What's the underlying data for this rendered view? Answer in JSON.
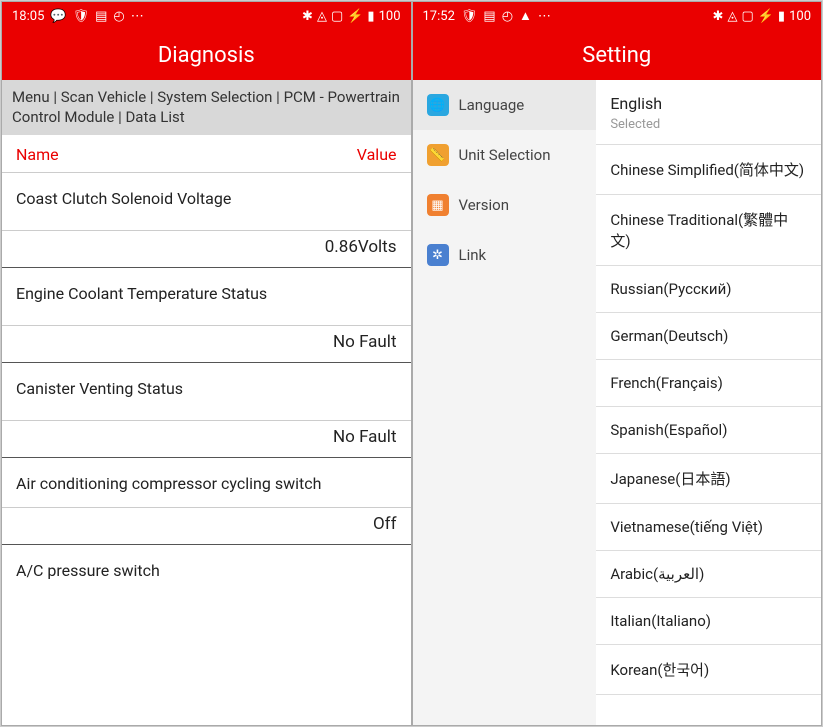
{
  "left": {
    "status": {
      "time": "18:05",
      "battery": "100"
    },
    "title": "Diagnosis",
    "breadcrumb": "Menu | Scan Vehicle | System Selection | PCM - Powertrain Control Module | Data List",
    "col_name": "Name",
    "col_value": "Value",
    "rows": [
      {
        "name": "Coast Clutch Solenoid Voltage",
        "value": "0.86Volts"
      },
      {
        "name": "Engine Coolant Temperature Status",
        "value": "No Fault"
      },
      {
        "name": "Canister Venting Status",
        "value": "No Fault"
      },
      {
        "name": "Air conditioning compressor cycling switch",
        "value": "Off"
      },
      {
        "name": "A/C pressure switch",
        "value": ""
      }
    ]
  },
  "right": {
    "status": {
      "time": "17:52",
      "battery": "100"
    },
    "title": "Setting",
    "menu": [
      {
        "label": "Language"
      },
      {
        "label": "Unit Selection"
      },
      {
        "label": "Version"
      },
      {
        "label": "Link"
      }
    ],
    "selected_lang": "English",
    "selected_sub": "Selected",
    "languages": [
      "Chinese Simplified(简体中文)",
      "Chinese Traditional(繁體中文)",
      "Russian(Русский)",
      "German(Deutsch)",
      "French(Français)",
      "Spanish(Español)",
      "Japanese(日本語)",
      "Vietnamese(tiếng Việt)",
      "Arabic(العربية)",
      "Italian(Italiano)",
      "Korean(한국어)"
    ]
  }
}
